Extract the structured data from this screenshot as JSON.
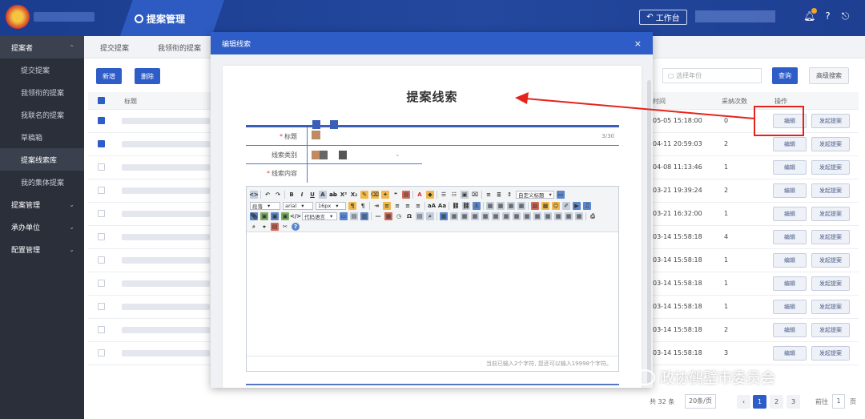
{
  "header": {
    "app_title": "提案管理",
    "workbench_label": "工作台",
    "notification_count": "0"
  },
  "sidebar": {
    "groups": [
      {
        "label": "提案者"
      },
      {
        "label": "提案管理"
      },
      {
        "label": "承办单位"
      },
      {
        "label": "配置管理"
      }
    ],
    "items": [
      {
        "label": "提交提案"
      },
      {
        "label": "我领衔的提案"
      },
      {
        "label": "我联名的提案"
      },
      {
        "label": "草稿箱"
      },
      {
        "label": "提案线索库"
      },
      {
        "label": "我的集体提案"
      }
    ]
  },
  "main": {
    "subtabs": [
      "提交提案",
      "我领衔的提案"
    ],
    "new_button": "新增",
    "delete_button": "删除",
    "year_placeholder": "选择年份",
    "query_button": "查询",
    "advanced_button": "高级搜索",
    "columns": {
      "title": "标题",
      "time": "时间",
      "adopt_count": "采纳次数",
      "action": "操作"
    },
    "rows": [
      {
        "checked": true,
        "time": "05-05 15:18:00",
        "count": "0"
      },
      {
        "checked": true,
        "time": "04-11 20:59:03",
        "count": "2"
      },
      {
        "checked": false,
        "time": "04-08 11:13:46",
        "count": "1"
      },
      {
        "checked": false,
        "time": "03-21 19:39:24",
        "count": "2"
      },
      {
        "checked": false,
        "time": "03-21 16:32:00",
        "count": "1"
      },
      {
        "checked": false,
        "time": "03-14 15:58:18",
        "count": "4"
      },
      {
        "checked": false,
        "time": "03-14 15:58:18",
        "count": "1"
      },
      {
        "checked": false,
        "time": "03-14 15:58:18",
        "count": "1"
      },
      {
        "checked": false,
        "time": "03-14 15:58:18",
        "count": "1"
      },
      {
        "checked": false,
        "time": "03-14 15:58:18",
        "count": "2"
      },
      {
        "checked": false,
        "time": "03-14 15:58:18",
        "count": "3"
      }
    ],
    "edit_label": "编辑",
    "initiate_label": "发起提案",
    "pager": {
      "total": "共 32 条",
      "page_size": "20条/页",
      "pages": [
        "1",
        "2",
        "3"
      ],
      "goto_label": "前往",
      "goto_value": "1",
      "page_unit": "页"
    }
  },
  "dialog": {
    "title": "编辑线索",
    "close": "×",
    "doc_title": "提案线索",
    "fields": {
      "title_label": "标题",
      "title_counter": "3/30",
      "category_label": "线索类别",
      "content_label": "线索内容"
    },
    "toolbar": {
      "paragraph_format": "段落",
      "font_family": "arial",
      "font_size": "16px",
      "custom_title": "自定义标题",
      "code_lang": "代码语言"
    },
    "status_text": "当前已输入2个字符, 您还可以输入19998个字符。"
  },
  "watermark": "政协鹤壁市委员会",
  "colors": {
    "primary": "#2f5dc7",
    "header": "#1b3d8f",
    "sidebar": "#2a2f3a",
    "annotation": "#e5231d"
  }
}
